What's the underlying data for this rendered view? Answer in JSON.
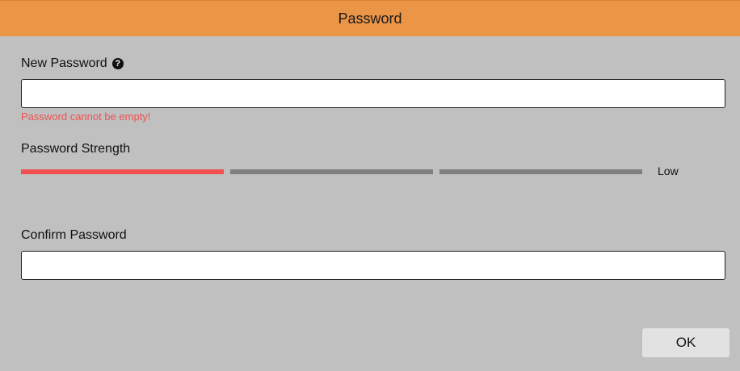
{
  "dialog": {
    "title": "Password"
  },
  "new_password": {
    "label": "New Password",
    "help_icon": "question-circle-icon",
    "help_glyph": "?",
    "value": "",
    "placeholder": "",
    "error": "Password cannot be empty!"
  },
  "strength": {
    "label": "Password Strength",
    "level_text": "Low",
    "filled_segments": 1,
    "total_segments": 3,
    "colors": {
      "active": "#f24f4f",
      "inactive": "#7f7f7f"
    }
  },
  "confirm_password": {
    "label": "Confirm Password",
    "value": "",
    "placeholder": ""
  },
  "actions": {
    "ok_label": "OK"
  },
  "colors": {
    "header_bg": "#eb9647",
    "dialog_bg": "#c0c0c0",
    "error_text": "#f05050",
    "button_bg": "#e2e2e2"
  }
}
